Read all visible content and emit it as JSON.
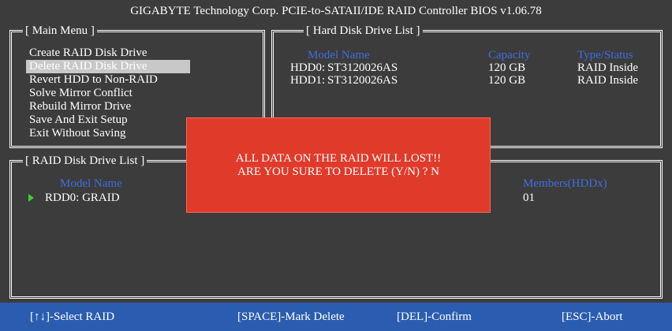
{
  "header": {
    "title": "GIGABYTE Technology Corp. PCIE-to-SATAII/IDE RAID Controller BIOS v1.06.78"
  },
  "main_menu": {
    "title": "[ Main Menu ]",
    "items": [
      "Create RAID Disk Drive",
      "Delete RAID Disk Drive",
      "Revert HDD to Non-RAID",
      "Solve Mirror Conflict",
      "Rebuild Mirror Drive",
      "Save And Exit Setup",
      "Exit Without Saving"
    ],
    "selected_index": 1
  },
  "hdd_list": {
    "title": "[ Hard Disk Drive List ]",
    "headers": {
      "model": "Model Name",
      "capacity": "Capacity",
      "type": "Type/Status"
    },
    "rows": [
      {
        "id": "HDD0:",
        "model": "ST3120026AS",
        "capacity": "120 GB",
        "type": "RAID Inside"
      },
      {
        "id": "HDD1:",
        "model": "ST3120026AS",
        "capacity": "120 GB",
        "type": "RAID Inside"
      }
    ]
  },
  "raid_list": {
    "title": "[ RAID Disk Drive List ]",
    "headers": {
      "model": "Model Name",
      "members": "Members(HDDx)"
    },
    "rows": [
      {
        "name": "RDD0: GRAID",
        "members": "01"
      }
    ]
  },
  "dialog": {
    "line1": "ALL DATA ON THE RAID WILL LOST!!",
    "line2": "ARE YOU SURE TO DELETE (Y/N) ? N"
  },
  "footer": {
    "select": "[↑↓]-Select RAID",
    "mark": "[SPACE]-Mark Delete",
    "confirm": "[DEL]-Confirm",
    "abort": "[ESC]-Abort"
  },
  "colors": {
    "background": "#3c3c3c",
    "main_border": "#58c858",
    "hdd_border": "#66a8c8",
    "raid_border": "#d8c838",
    "header_text": "#3f6fe0",
    "dialog_bg": "#e03a2a",
    "footer_bg": "#2a5db0",
    "selection": "#c8c8c8"
  }
}
